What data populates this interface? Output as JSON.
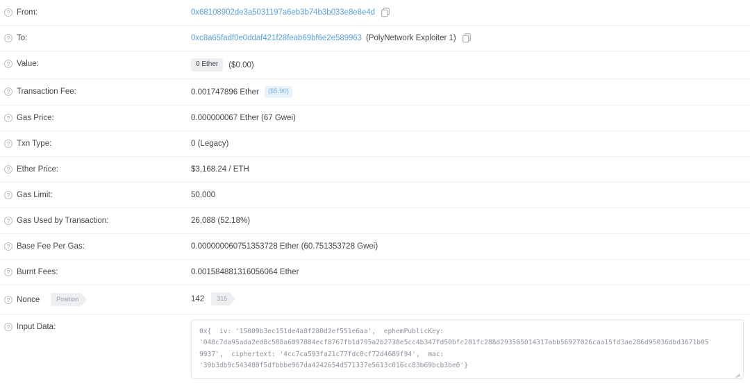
{
  "rows": [
    {
      "key": "from",
      "label": "From:",
      "help_icon": "question-mark-icon",
      "type": "address",
      "address": "0x68108902de3a5031197a6eb3b74b3b033e8e8e4d",
      "tag": "",
      "copy_icon": "copy-icon"
    },
    {
      "key": "to",
      "label": "To:",
      "help_icon": "question-mark-icon",
      "type": "address",
      "address": "0xc8a65fadf0e0ddaf421f28feab69bf6e2e589963",
      "tag": "(PolyNetwork Exploiter 1)",
      "copy_icon": "copy-icon"
    },
    {
      "key": "value",
      "label": "Value:",
      "help_icon": "question-mark-icon",
      "type": "value",
      "badge": "0 Ether",
      "usd": "($0.00)"
    },
    {
      "key": "transaction_fee",
      "label": "Transaction Fee:",
      "help_icon": "question-mark-icon",
      "type": "fee",
      "text": "0.001747896 Ether",
      "usd_badge": "($5.90)"
    },
    {
      "key": "gas_price",
      "label": "Gas Price:",
      "help_icon": "question-mark-icon",
      "type": "text",
      "text": "0.000000067 Ether (67 Gwei)"
    },
    {
      "key": "txn_type",
      "label": "Txn Type:",
      "help_icon": "question-mark-icon",
      "type": "text",
      "text": "0 (Legacy)"
    },
    {
      "key": "ether_price",
      "label": "Ether Price:",
      "help_icon": "question-mark-icon",
      "type": "text",
      "text": "$3,168.24 / ETH"
    },
    {
      "key": "gas_limit",
      "label": "Gas Limit:",
      "help_icon": "question-mark-icon",
      "type": "text",
      "text": "50,000"
    },
    {
      "key": "gas_used",
      "label": "Gas Used by Transaction:",
      "help_icon": "question-mark-icon",
      "type": "text",
      "text": "26,088 (52.18%)"
    },
    {
      "key": "base_fee",
      "label": "Base Fee Per Gas:",
      "help_icon": "question-mark-icon",
      "type": "text",
      "text": "0.000000060751353728 Ether (60.751353728 Gwei)"
    },
    {
      "key": "burnt_fees",
      "label": "Burnt Fees:",
      "help_icon": "question-mark-icon",
      "type": "text",
      "text": "0.001584881316056064 Ether"
    },
    {
      "key": "nonce",
      "label": "Nonce",
      "help_icon": "question-mark-icon",
      "type": "nonce",
      "position_badge": "Position",
      "nonce_value": "142",
      "position_value": "315"
    },
    {
      "key": "input_data",
      "label": "Input Data:",
      "help_icon": "question-mark-icon",
      "type": "inputdata",
      "input_data_text": "0x{  iv: '15009b3ec151de4a8f280d2ef551e6aa',  ephemPublicKey:\n'048c7da95ada2ed8c588a6097884ecf8767fb1d795a2b2738e5cc4b347fd50bfc281fc288d293585014317abb56927026caa15fd3ae286d95036dbd3671b05\n9937',  ciphertext: '4cc7ca593fa21c77fdc0cf72d4689f94',  mac:\n'39b3db9c543480f5dfbbbe967da4242654d571337e5613c016cc83b69bcb3be0'}"
    }
  ],
  "colors": {
    "link": "#5aa0e0",
    "text": "#41464b",
    "badge_grey_bg": "#eceef0",
    "badge_blue_bg": "#e7f2fb",
    "badge_blue_text": "#7fb3e3",
    "row_border": "#eceff1",
    "box_border": "#e3e6e9",
    "mono_text": "#8b929a"
  }
}
